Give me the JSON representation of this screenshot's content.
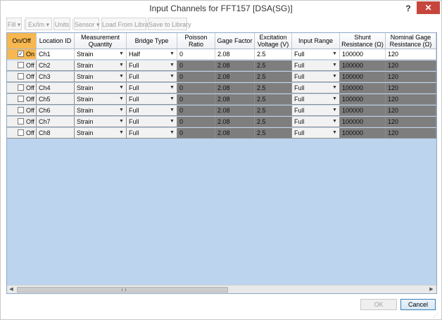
{
  "window": {
    "title": "Input Channels for  FFT157 [DSA(SG)]",
    "help": "?",
    "close": "✕"
  },
  "toolbar": {
    "fill": "Fill ▾",
    "exim": "Ex/Im ▾",
    "units": "Units",
    "sensor": "Sensor ▾",
    "load": "Load From Library",
    "save": "Save to Library"
  },
  "columns": [
    "On/Off",
    "Location ID",
    "Measurement Quantity",
    "Bridge Type",
    "Poisson Ratio",
    "Gage Factor",
    "Excitation Voltage (V)",
    "Input Range",
    "Shunt Resistance (Ω)",
    "Nominal Gage Resistance (Ω)"
  ],
  "rows": [
    {
      "checked": "✓",
      "state": "On",
      "location": "Ch1",
      "quantity": "Strain",
      "bridge": "Half",
      "poisson": "0",
      "gage": "2.08",
      "excitation": "2.5",
      "range": "Full",
      "shunt": "100000",
      "nominal": "120"
    },
    {
      "checked": "",
      "state": "Off",
      "location": "Ch2",
      "quantity": "Strain",
      "bridge": "Full",
      "poisson": "0",
      "gage": "2.08",
      "excitation": "2.5",
      "range": "Full",
      "shunt": "100000",
      "nominal": "120"
    },
    {
      "checked": "",
      "state": "Off",
      "location": "Ch3",
      "quantity": "Strain",
      "bridge": "Full",
      "poisson": "0",
      "gage": "2.08",
      "excitation": "2.5",
      "range": "Full",
      "shunt": "100000",
      "nominal": "120"
    },
    {
      "checked": "",
      "state": "Off",
      "location": "Ch4",
      "quantity": "Strain",
      "bridge": "Full",
      "poisson": "0",
      "gage": "2.08",
      "excitation": "2.5",
      "range": "Full",
      "shunt": "100000",
      "nominal": "120"
    },
    {
      "checked": "",
      "state": "Off",
      "location": "Ch5",
      "quantity": "Strain",
      "bridge": "Full",
      "poisson": "0",
      "gage": "2.08",
      "excitation": "2.5",
      "range": "Full",
      "shunt": "100000",
      "nominal": "120"
    },
    {
      "checked": "",
      "state": "Off",
      "location": "Ch6",
      "quantity": "Strain",
      "bridge": "Full",
      "poisson": "0",
      "gage": "2.08",
      "excitation": "2.5",
      "range": "Full",
      "shunt": "100000",
      "nominal": "120"
    },
    {
      "checked": "",
      "state": "Off",
      "location": "Ch7",
      "quantity": "Strain",
      "bridge": "Full",
      "poisson": "0",
      "gage": "2.08",
      "excitation": "2.5",
      "range": "Full",
      "shunt": "100000",
      "nominal": "120"
    },
    {
      "checked": "",
      "state": "Off",
      "location": "Ch8",
      "quantity": "Strain",
      "bridge": "Full",
      "poisson": "0",
      "gage": "2.08",
      "excitation": "2.5",
      "range": "Full",
      "shunt": "100000",
      "nominal": "120"
    }
  ],
  "footer": {
    "ok": "OK",
    "cancel": "Cancel"
  },
  "colors": {
    "selected_header": "#f7b851",
    "disabled_row": "#7e7e7e",
    "grid_background": "#bcd4ee",
    "close_button": "#c7463c"
  }
}
